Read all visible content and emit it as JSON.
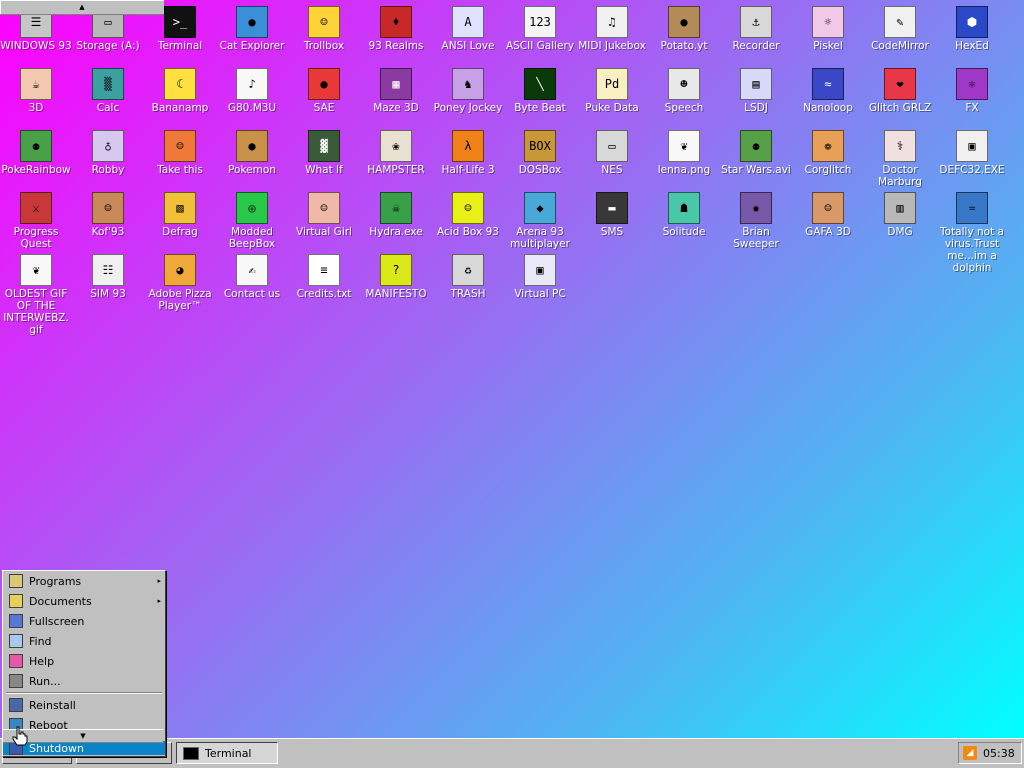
{
  "desktop": {
    "icons": [
      {
        "label": "WINDOWS 93",
        "col": 0,
        "row": 0,
        "bg": "#c6c6c6",
        "glyph": "☰"
      },
      {
        "label": "Storage (A:)",
        "col": 1,
        "row": 0,
        "bg": "#b8b8b8",
        "glyph": "▭"
      },
      {
        "label": "Terminal",
        "col": 2,
        "row": 0,
        "bg": "#111111",
        "glyph": ">_"
      },
      {
        "label": "Cat Explorer",
        "col": 3,
        "row": 0,
        "bg": "#3a8fd6",
        "glyph": "●"
      },
      {
        "label": "Trollbox",
        "col": 4,
        "row": 0,
        "bg": "#ffd23a",
        "glyph": "☺"
      },
      {
        "label": "93 Realms",
        "col": 5,
        "row": 0,
        "bg": "#c82828",
        "glyph": "♦"
      },
      {
        "label": "ANSI Love",
        "col": 6,
        "row": 0,
        "bg": "#e0e0ff",
        "glyph": "A"
      },
      {
        "label": "ASCII Gallery",
        "col": 7,
        "row": 0,
        "bg": "#f4f4f4",
        "glyph": "123"
      },
      {
        "label": "MIDI Jukebox",
        "col": 8,
        "row": 0,
        "bg": "#f0f0f0",
        "glyph": "♫"
      },
      {
        "label": "Potato.yt",
        "col": 9,
        "row": 0,
        "bg": "#b48a58",
        "glyph": "●"
      },
      {
        "label": "Recorder",
        "col": 10,
        "row": 0,
        "bg": "#d8d8d8",
        "glyph": "⚓"
      },
      {
        "label": "Piskel",
        "col": 11,
        "row": 0,
        "bg": "#f2c8e8",
        "glyph": "☼"
      },
      {
        "label": "CodeMirror",
        "col": 12,
        "row": 0,
        "bg": "#f0f0f0",
        "glyph": "✎"
      },
      {
        "label": "HexEd",
        "col": 13,
        "row": 0,
        "bg": "#2a48c8",
        "glyph": "⬢"
      },
      {
        "label": "3D",
        "col": 0,
        "row": 1,
        "bg": "#f4c8b0",
        "glyph": "☕"
      },
      {
        "label": "Calc",
        "col": 1,
        "row": 1,
        "bg": "#3aa0a0",
        "glyph": "▒"
      },
      {
        "label": "Bananamp",
        "col": 2,
        "row": 1,
        "bg": "#ffe040",
        "glyph": "☾"
      },
      {
        "label": "G80.M3U",
        "col": 3,
        "row": 1,
        "bg": "#f8f8f8",
        "glyph": "♪"
      },
      {
        "label": "SAE",
        "col": 4,
        "row": 1,
        "bg": "#e83838",
        "glyph": "●"
      },
      {
        "label": "Maze 3D",
        "col": 5,
        "row": 1,
        "bg": "#8a3aa0",
        "glyph": "▦"
      },
      {
        "label": "Poney Jockey",
        "col": 6,
        "row": 1,
        "bg": "#c8a0e8",
        "glyph": "♞"
      },
      {
        "label": "Byte Beat",
        "col": 7,
        "row": 1,
        "bg": "#0a3a0a",
        "glyph": "╲"
      },
      {
        "label": "Puke Data",
        "col": 8,
        "row": 1,
        "bg": "#f8f0c0",
        "glyph": "Pd"
      },
      {
        "label": "Speech",
        "col": 9,
        "row": 1,
        "bg": "#e8e8e8",
        "glyph": "☻"
      },
      {
        "label": "LSDJ",
        "col": 10,
        "row": 1,
        "bg": "#d8d8f8",
        "glyph": "▤"
      },
      {
        "label": "Nanoloop",
        "col": 11,
        "row": 1,
        "bg": "#3a48c8",
        "glyph": "≈"
      },
      {
        "label": "Glitch GRLZ",
        "col": 12,
        "row": 1,
        "bg": "#e83848",
        "glyph": "❤"
      },
      {
        "label": "FX",
        "col": 13,
        "row": 1,
        "bg": "#a038c8",
        "glyph": "⚛"
      },
      {
        "label": "PokeRainbow",
        "col": 0,
        "row": 2,
        "bg": "#48a048",
        "glyph": "⚉"
      },
      {
        "label": "Robby",
        "col": 1,
        "row": 2,
        "bg": "#d8c8f0",
        "glyph": "♁"
      },
      {
        "label": "Take this",
        "col": 2,
        "row": 2,
        "bg": "#f07838",
        "glyph": "☺"
      },
      {
        "label": "Pokemon",
        "col": 3,
        "row": 2,
        "bg": "#c89048",
        "glyph": "●"
      },
      {
        "label": "What If",
        "col": 4,
        "row": 2,
        "bg": "#3a5a3a",
        "glyph": "▓"
      },
      {
        "label": "HAMPSTER",
        "col": 5,
        "row": 2,
        "bg": "#e8e0d0",
        "glyph": "❀"
      },
      {
        "label": "Half-Life 3",
        "col": 6,
        "row": 2,
        "bg": "#f08018",
        "glyph": "λ"
      },
      {
        "label": "DOSBox",
        "col": 7,
        "row": 2,
        "bg": "#c89838",
        "glyph": "BOX"
      },
      {
        "label": "NES",
        "col": 8,
        "row": 2,
        "bg": "#d8d8d8",
        "glyph": "▭"
      },
      {
        "label": "lenna.png",
        "col": 9,
        "row": 2,
        "bg": "#f8f8f8",
        "glyph": "❦"
      },
      {
        "label": "Star Wars.avi",
        "col": 10,
        "row": 2,
        "bg": "#58a048",
        "glyph": "⚉"
      },
      {
        "label": "Corglitch",
        "col": 11,
        "row": 2,
        "bg": "#e8a058",
        "glyph": "❁"
      },
      {
        "label": "Doctor Marburg",
        "col": 12,
        "row": 2,
        "bg": "#f0e0e0",
        "glyph": "⚕"
      },
      {
        "label": "DEFC32.EXE",
        "col": 13,
        "row": 2,
        "bg": "#f0f0f0",
        "glyph": "▣"
      },
      {
        "label": "Progress Quest",
        "col": 0,
        "row": 3,
        "bg": "#c83838",
        "glyph": "⚔"
      },
      {
        "label": "Kof'93",
        "col": 1,
        "row": 3,
        "bg": "#c88858",
        "glyph": "☺"
      },
      {
        "label": "Defrag",
        "col": 2,
        "row": 3,
        "bg": "#f0c038",
        "glyph": "▧"
      },
      {
        "label": "Modded BeepBox",
        "col": 3,
        "row": 3,
        "bg": "#28c848",
        "glyph": "◎"
      },
      {
        "label": "Virtual Girl",
        "col": 4,
        "row": 3,
        "bg": "#f0b8a8",
        "glyph": "☺"
      },
      {
        "label": "Hydra.exe",
        "col": 5,
        "row": 3,
        "bg": "#38a048",
        "glyph": "☠"
      },
      {
        "label": "Acid Box 93",
        "col": 6,
        "row": 3,
        "bg": "#e8f018",
        "glyph": "☺"
      },
      {
        "label": "Arena 93 multiplayer",
        "col": 7,
        "row": 3,
        "bg": "#48a8d8",
        "glyph": "◆"
      },
      {
        "label": "SMS",
        "col": 8,
        "row": 3,
        "bg": "#383838",
        "glyph": "▬"
      },
      {
        "label": "Solitude",
        "col": 9,
        "row": 3,
        "bg": "#48c8a8",
        "glyph": "☗"
      },
      {
        "label": "Brian Sweeper",
        "col": 10,
        "row": 3,
        "bg": "#7858a8",
        "glyph": "✹"
      },
      {
        "label": "GAFA 3D",
        "col": 11,
        "row": 3,
        "bg": "#d89868",
        "glyph": "☺"
      },
      {
        "label": "DMG",
        "col": 12,
        "row": 3,
        "bg": "#b8b8b8",
        "glyph": "▥"
      },
      {
        "label": "Totally not a virus.Trust me...im a dolphin",
        "col": 13,
        "row": 3,
        "bg": "#3878c8",
        "glyph": "♒"
      },
      {
        "label": "OLDEST GIF OF THE INTERWEBZ.gif",
        "col": 0,
        "row": 4,
        "bg": "#f8f8f8",
        "glyph": "❦"
      },
      {
        "label": "SIM 93",
        "col": 1,
        "row": 4,
        "bg": "#f0f0f0",
        "glyph": "☷"
      },
      {
        "label": "Adobe Pizza Player™",
        "col": 2,
        "row": 4,
        "bg": "#f0a838",
        "glyph": "◕"
      },
      {
        "label": "Contact us",
        "col": 3,
        "row": 4,
        "bg": "#f8f8f8",
        "glyph": "✍"
      },
      {
        "label": "Credits.txt",
        "col": 4,
        "row": 4,
        "bg": "#ffffff",
        "glyph": "≡"
      },
      {
        "label": "MANIFESTO",
        "col": 5,
        "row": 4,
        "bg": "#d8e818",
        "glyph": "?"
      },
      {
        "label": "TRASH",
        "col": 6,
        "row": 4,
        "bg": "#d8d8d8",
        "glyph": "♻"
      },
      {
        "label": "Virtual PC",
        "col": 7,
        "row": 4,
        "bg": "#e8e8f8",
        "glyph": "▣"
      }
    ]
  },
  "start_menu": {
    "items": [
      {
        "label": "Programs",
        "has_submenu": true,
        "icon_color": "#d8c878"
      },
      {
        "label": "Documents",
        "has_submenu": true,
        "icon_color": "#e8d058"
      },
      {
        "label": "Fullscreen",
        "has_submenu": false,
        "icon_color": "#5878d8"
      },
      {
        "label": "Find",
        "has_submenu": false,
        "icon_color": "#a8c8e8"
      },
      {
        "label": "Help",
        "has_submenu": false,
        "icon_color": "#e858a8"
      },
      {
        "label": "Run...",
        "has_submenu": false,
        "icon_color": "#888888"
      },
      {
        "label": "Reinstall",
        "has_submenu": false,
        "icon_color": "#4868a8"
      },
      {
        "label": "Reboot",
        "has_submenu": false,
        "icon_color": "#3888c8"
      },
      {
        "label": "Shutdown",
        "has_submenu": false,
        "icon_color": "#3858a8",
        "selected": true
      }
    ],
    "submenu_arrow": "▸",
    "scroll_up_arrow": "▲",
    "scroll_down_arrow": "▼"
  },
  "taskbar": {
    "active_task_label": "Terminal",
    "clock": "05:38",
    "tray_icon": "rss-icon"
  },
  "colors": {
    "selection": "#0a84c8",
    "chrome": "#c0c0c0"
  }
}
